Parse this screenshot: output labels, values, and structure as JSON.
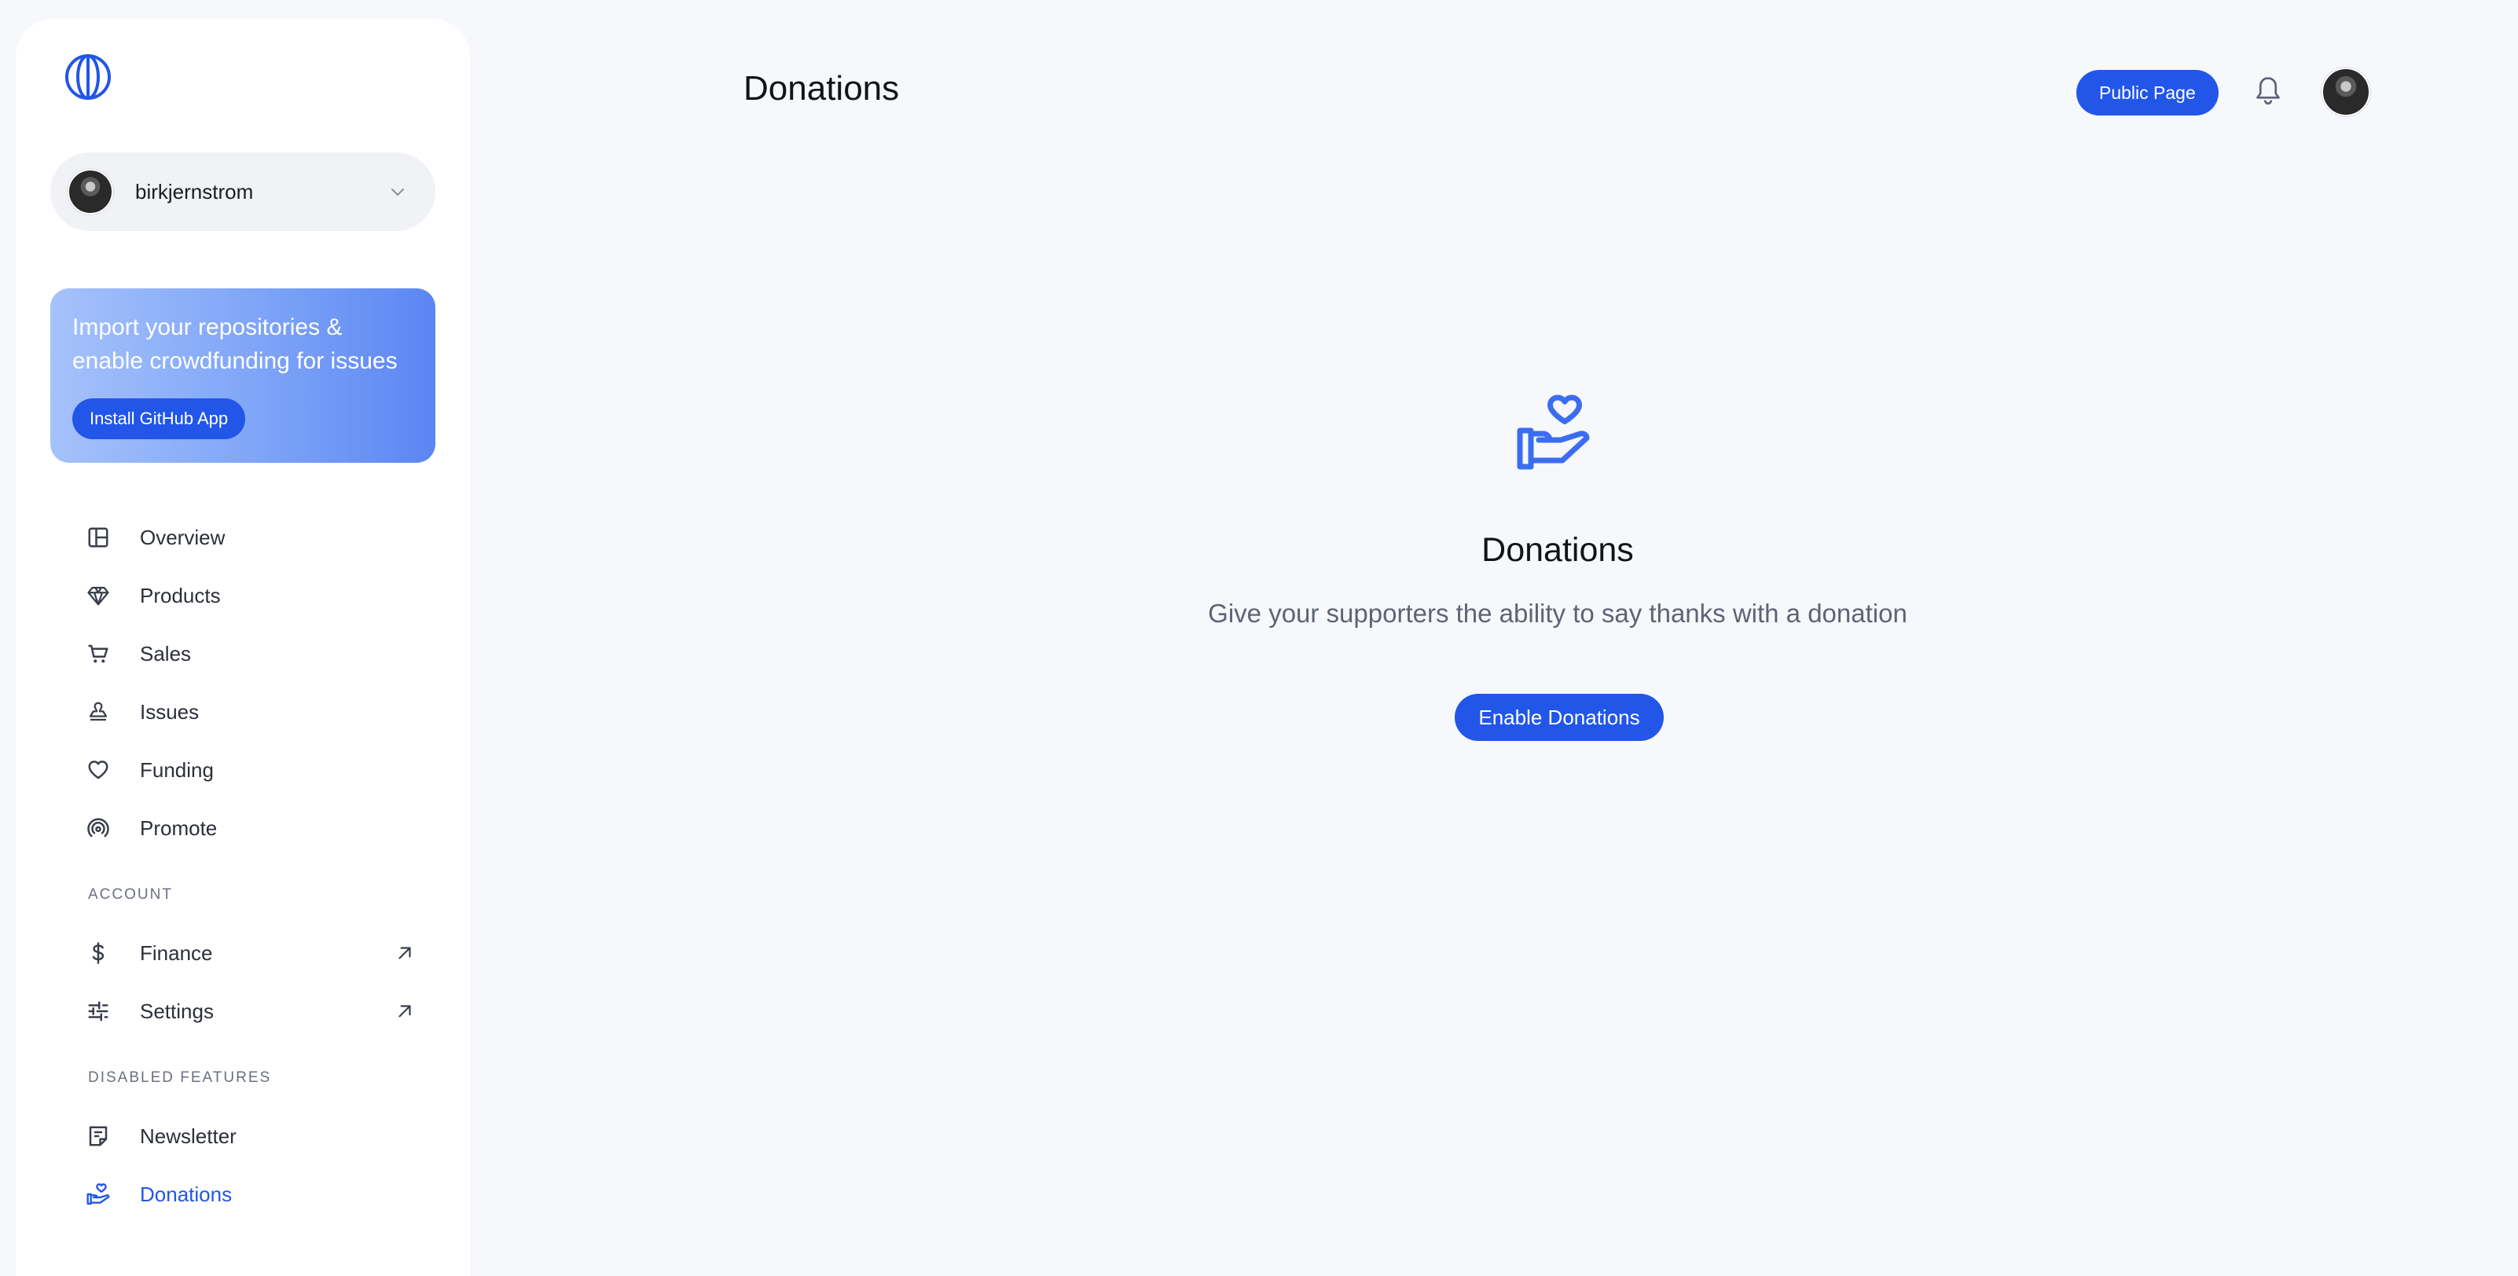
{
  "app": {
    "accent_color": "#2256e8",
    "logo_icon": "polar-logo-icon"
  },
  "account_switcher": {
    "name": "birkjernstrom",
    "icon": "chevron-down-icon"
  },
  "promo": {
    "text": "Import your repositories & enable crowdfunding for issues",
    "button_label": "Install GitHub App"
  },
  "sidebar": {
    "items": [
      {
        "label": "Overview",
        "icon": "layout-icon"
      },
      {
        "label": "Products",
        "icon": "diamond-icon"
      },
      {
        "label": "Sales",
        "icon": "cart-icon"
      },
      {
        "label": "Issues",
        "icon": "issues-icon"
      },
      {
        "label": "Funding",
        "icon": "heart-icon"
      },
      {
        "label": "Promote",
        "icon": "broadcast-icon"
      }
    ],
    "account_section_title": "ACCOUNT",
    "account_items": [
      {
        "label": "Finance",
        "icon": "dollar-icon",
        "external": true
      },
      {
        "label": "Settings",
        "icon": "sliders-icon",
        "external": true
      }
    ],
    "disabled_section_title": "DISABLED FEATURES",
    "disabled_items": [
      {
        "label": "Newsletter",
        "icon": "newsletter-icon"
      },
      {
        "label": "Donations",
        "icon": "donation-hand-icon",
        "active": true
      }
    ]
  },
  "header": {
    "title": "Donations",
    "public_page_label": "Public Page",
    "notifications_icon": "bell-icon"
  },
  "empty_state": {
    "icon": "donation-hand-heart-icon",
    "title": "Donations",
    "description": "Give your supporters the ability to say thanks with a donation",
    "button_label": "Enable Donations"
  }
}
